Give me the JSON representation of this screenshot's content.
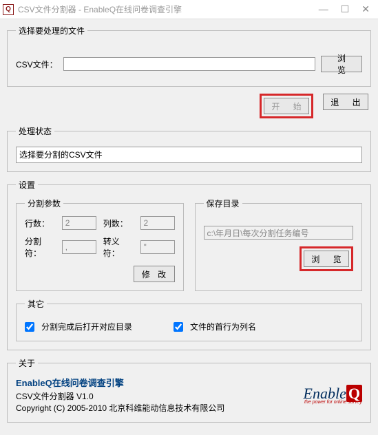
{
  "window": {
    "icon_letter": "Q",
    "title": "CSV文件分割器 - EnableQ在线问卷调查引擎"
  },
  "file_section": {
    "legend": "选择要处理的文件",
    "label": "CSV文件：",
    "value": "",
    "browse": "浏 览"
  },
  "actions": {
    "start": "开 始",
    "exit": "退 出"
  },
  "status_section": {
    "legend": "处理状态",
    "text": "选择要分割的CSV文件"
  },
  "settings": {
    "legend": "设置",
    "params": {
      "legend": "分割参数",
      "rows_label": "行数：",
      "rows_value": "2",
      "cols_label": "列数：",
      "cols_value": "2",
      "sep_label": "分割符：",
      "sep_value": ",",
      "esc_label": "转义符：",
      "esc_value": "\"",
      "modify": "修 改"
    },
    "savedir": {
      "legend": "保存目录",
      "value": "c:\\年月日\\每次分割任务编号",
      "browse": "浏 览"
    },
    "other": {
      "legend": "其它",
      "open_after": "分割完成后打开对应目录",
      "first_row_header": "文件的首行为列名"
    }
  },
  "about": {
    "legend": "关于",
    "title": "EnableQ在线问卷调查引擎",
    "sub": "CSV文件分割器  V1.0",
    "copyright": "Copyright (C) 2005-2010 北京科维能动信息技术有限公司",
    "logo_tag": "the power for online survey"
  }
}
